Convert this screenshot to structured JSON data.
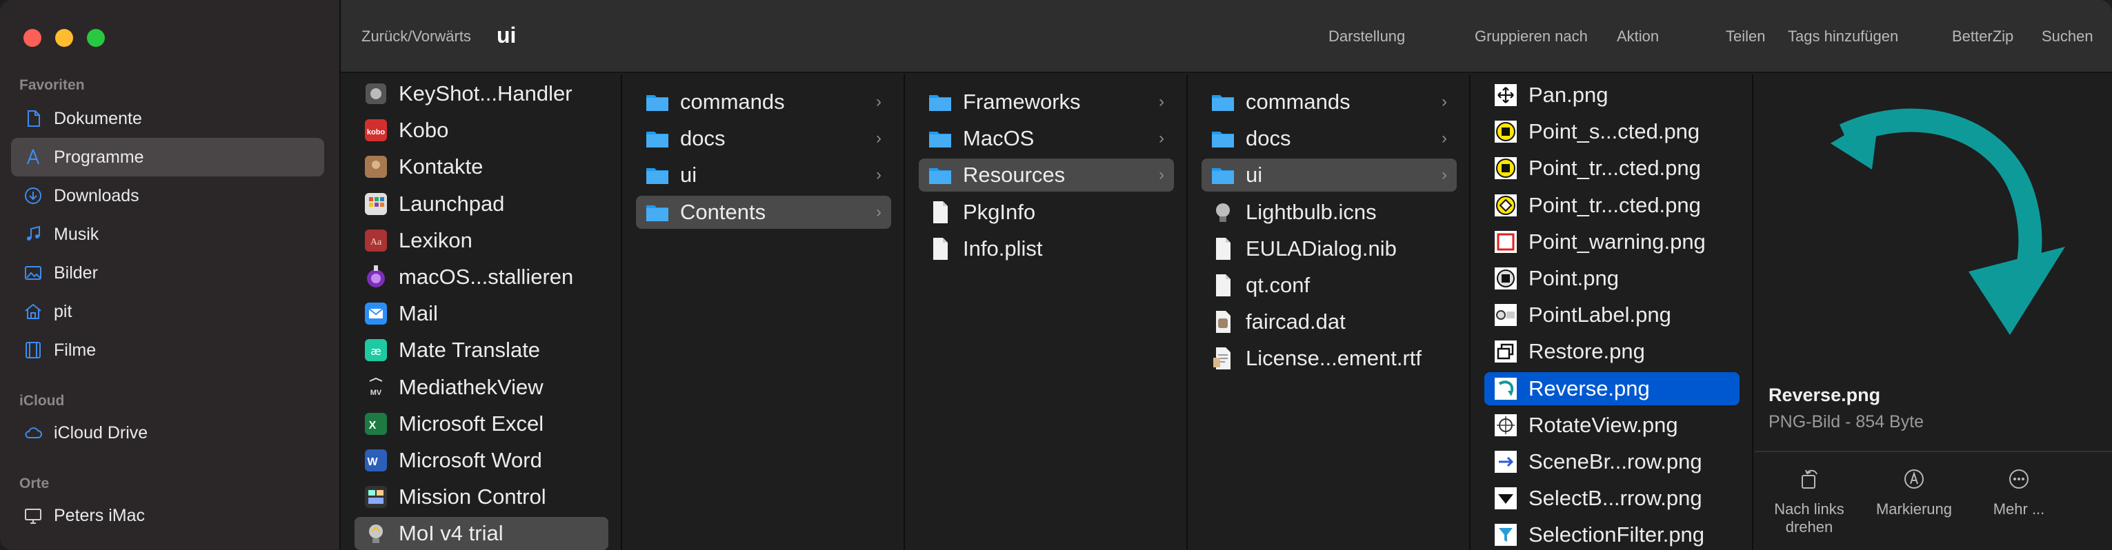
{
  "sidebar": {
    "favorites_header": "Favoriten",
    "favorites": [
      {
        "label": "Dokumente",
        "icon": "document-icon"
      },
      {
        "label": "Programme",
        "icon": "applications-icon",
        "selected": true
      },
      {
        "label": "Downloads",
        "icon": "downloads-icon"
      },
      {
        "label": "Musik",
        "icon": "music-icon"
      },
      {
        "label": "Bilder",
        "icon": "photos-icon"
      },
      {
        "label": "pit",
        "icon": "home-icon"
      },
      {
        "label": "Filme",
        "icon": "movies-icon"
      }
    ],
    "icloud_header": "iCloud",
    "icloud": [
      {
        "label": "iCloud Drive",
        "icon": "cloud-icon"
      }
    ],
    "places_header": "Orte",
    "places": [
      {
        "label": "Peters iMac",
        "icon": "imac-icon"
      }
    ]
  },
  "toolbar": {
    "nav_label": "Zurück/Vorwärts",
    "title": "ui",
    "view_label": "Darstellung",
    "group_label": "Gruppieren nach",
    "action_label": "Aktion",
    "share_label": "Teilen",
    "tags_label": "Tags hinzufügen",
    "betterzip_label": "BetterZip",
    "search_label": "Suchen"
  },
  "column1": [
    {
      "label": "KeyShot...Handler",
      "icon": "keyshot-icon"
    },
    {
      "label": "Kobo",
      "icon": "kobo-icon"
    },
    {
      "label": "Kontakte",
      "icon": "contacts-icon"
    },
    {
      "label": "Launchpad",
      "icon": "launchpad-icon"
    },
    {
      "label": "Lexikon",
      "icon": "dictionary-icon"
    },
    {
      "label": "macOS...stallieren",
      "icon": "macos-installer-icon"
    },
    {
      "label": "Mail",
      "icon": "mail-icon"
    },
    {
      "label": "Mate Translate",
      "icon": "translate-icon"
    },
    {
      "label": "MediathekView",
      "icon": "mediathek-icon"
    },
    {
      "label": "Microsoft Excel",
      "icon": "excel-icon"
    },
    {
      "label": "Microsoft Word",
      "icon": "word-icon"
    },
    {
      "label": "Mission Control",
      "icon": "mission-control-icon"
    },
    {
      "label": "MoI v4 trial",
      "icon": "moi-icon",
      "selected": true
    }
  ],
  "column2": [
    {
      "label": "commands",
      "icon": "folder-icon",
      "folder": true
    },
    {
      "label": "docs",
      "icon": "folder-icon",
      "folder": true
    },
    {
      "label": "ui",
      "icon": "folder-icon",
      "folder": true
    },
    {
      "label": "Contents",
      "icon": "folder-icon",
      "folder": true,
      "selected": true
    }
  ],
  "column3": [
    {
      "label": "Frameworks",
      "icon": "folder-icon",
      "folder": true
    },
    {
      "label": "MacOS",
      "icon": "folder-icon",
      "folder": true
    },
    {
      "label": "Resources",
      "icon": "folder-icon",
      "folder": true,
      "selected": true
    },
    {
      "label": "PkgInfo",
      "icon": "file-icon"
    },
    {
      "label": "Info.plist",
      "icon": "file-icon"
    }
  ],
  "column4": [
    {
      "label": "commands",
      "icon": "folder-icon",
      "folder": true
    },
    {
      "label": "docs",
      "icon": "folder-icon",
      "folder": true
    },
    {
      "label": "ui",
      "icon": "folder-icon",
      "folder": true,
      "selected": true
    },
    {
      "label": "Lightbulb.icns",
      "icon": "lightbulb-icon"
    },
    {
      "label": "EULADialog.nib",
      "icon": "file-icon"
    },
    {
      "label": "qt.conf",
      "icon": "file-icon"
    },
    {
      "label": "faircad.dat",
      "icon": "dat-file-icon"
    },
    {
      "label": "License...ement.rtf",
      "icon": "rtf-file-icon"
    }
  ],
  "column5": [
    {
      "label": "Pan.png",
      "icon": "pan-icon"
    },
    {
      "label": "Point_s...cted.png",
      "icon": "point-yellow-icon"
    },
    {
      "label": "Point_tr...cted.png",
      "icon": "point-yellow-icon"
    },
    {
      "label": "Point_tr...cted.png",
      "icon": "point-yellow-diamond-icon"
    },
    {
      "label": "Point_warning.png",
      "icon": "point-warning-icon"
    },
    {
      "label": "Point.png",
      "icon": "point-icon"
    },
    {
      "label": "PointLabel.png",
      "icon": "point-label-icon"
    },
    {
      "label": "Restore.png",
      "icon": "restore-icon"
    },
    {
      "label": "Reverse.png",
      "icon": "reverse-icon",
      "selected": true
    },
    {
      "label": "RotateView.png",
      "icon": "rotate-view-icon"
    },
    {
      "label": "SceneBr...row.png",
      "icon": "arrow-icon"
    },
    {
      "label": "SelectB...rrow.png",
      "icon": "select-arrow-icon"
    },
    {
      "label": "SelectionFilter.png",
      "icon": "filter-icon"
    }
  ],
  "preview": {
    "name": "Reverse.png",
    "subtitle": "PNG-Bild - 854 Byte",
    "actions": [
      {
        "label": "Nach links drehen",
        "icon": "rotate-left-icon"
      },
      {
        "label": "Markierung",
        "icon": "markup-icon"
      },
      {
        "label": "Mehr ...",
        "icon": "more-icon"
      }
    ]
  },
  "colors": {
    "accent": "#0058d0",
    "folder": "#1e9bf0",
    "preview_arrow": "#0f9a9a"
  }
}
